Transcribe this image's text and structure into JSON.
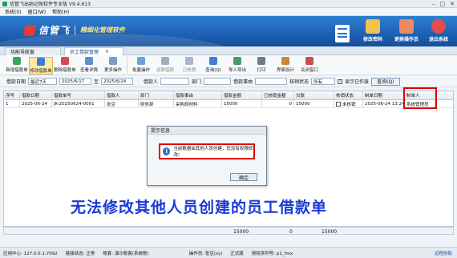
{
  "window": {
    "title": "信管飞出纳记账软件专业版 V9.4.613",
    "controls": [
      "–",
      "□",
      "✕"
    ]
  },
  "menu": [
    "系统(S)",
    "窗口(W)",
    "帮助(H)"
  ],
  "banner": {
    "logo": "信管飞",
    "slogan": "精细化管理软件",
    "buttons": [
      {
        "label": "修改密码",
        "icon": "key-icon",
        "color": "#f2c14e"
      },
      {
        "label": "更换操作员",
        "icon": "user-switch-icon",
        "color": "#f08a5d"
      },
      {
        "label": "退出系统",
        "icon": "exit-icon",
        "color": "#e54b4b"
      }
    ]
  },
  "tabs": [
    {
      "label": "功能导航窗"
    },
    {
      "label": "员工借款管理"
    }
  ],
  "toolbar": [
    {
      "label": "新增借款单",
      "icon": "add-doc-icon",
      "color": "#3aa757"
    },
    {
      "label": "修改借款单",
      "icon": "edit-doc-icon",
      "color": "#3b7bd6"
    },
    {
      "label": "删除借款单",
      "icon": "delete-doc-icon",
      "color": "#d84a4a"
    },
    {
      "label": "查看详情",
      "icon": "detail-icon",
      "color": "#5b8fd0"
    },
    {
      "label": "更多操作",
      "icon": "more-icon",
      "color": "#7a9bc2"
    },
    {
      "label": "批量操作",
      "icon": "batch-icon",
      "color": "#6fa0d6"
    },
    {
      "label": "还款借款",
      "icon": "repay-icon",
      "color": "#9bb0c6"
    },
    {
      "label": "已核销",
      "icon": "verified-icon",
      "color": "#a9b8c8"
    },
    {
      "label": "查询(Q)",
      "icon": "query-icon",
      "color": "#3f7fd0"
    },
    {
      "label": "导入导出",
      "icon": "import-export-icon",
      "color": "#4c9a6a"
    },
    {
      "label": "打印",
      "icon": "print-icon",
      "color": "#6b7d90"
    },
    {
      "label": "界面设计",
      "icon": "design-icon",
      "color": "#c48a3a"
    },
    {
      "label": "关闭窗口",
      "icon": "close-window-icon",
      "color": "#c95050"
    }
  ],
  "filter": {
    "date_label": "借款日期",
    "range_value": "最近7天",
    "date_from": "2025/6/17",
    "to": "至",
    "date_to": "2025/6/24",
    "borrower_label": "借款人",
    "dept_label": "部门",
    "reason_label": "借款事由",
    "status_label": "核销状态",
    "status_value": "所有",
    "show_void_label": "显示已作废",
    "query_label": "查询(Q)"
  },
  "table": {
    "headers": [
      "序号",
      "借款日期",
      "借款单号",
      "借款人",
      "部门",
      "借款事由",
      "借款金额",
      "已核销金额",
      "欠款",
      "核销状态",
      "制单日期",
      "制单人"
    ],
    "rows": [
      [
        "1",
        "2025-06-24",
        "JK-20250624-0001",
        "张豆",
        "财务部",
        "采购原材料",
        "15000",
        "0",
        "15000",
        "未核销",
        "2025-06-24 13:24",
        "系统管理员"
      ]
    ],
    "footer": {
      "amount": "15000",
      "verified": "0",
      "due": "15000"
    }
  },
  "dialog": {
    "title": "提示信息",
    "message": "当前数据由其他人员创建，您没有权限修改!",
    "ok": "确定"
  },
  "caption": "无法修改其他人员创建的员工借款单",
  "status": {
    "center": "应用中心: 127.0.0.1:7092",
    "link": "链接状态: 正常",
    "book": "账套: 演示账套(系统账)",
    "operator": "操作员: 张豆(zy)",
    "edition": "正式版",
    "license": "授权序列号: p1_fmx",
    "support": "远程协助"
  }
}
